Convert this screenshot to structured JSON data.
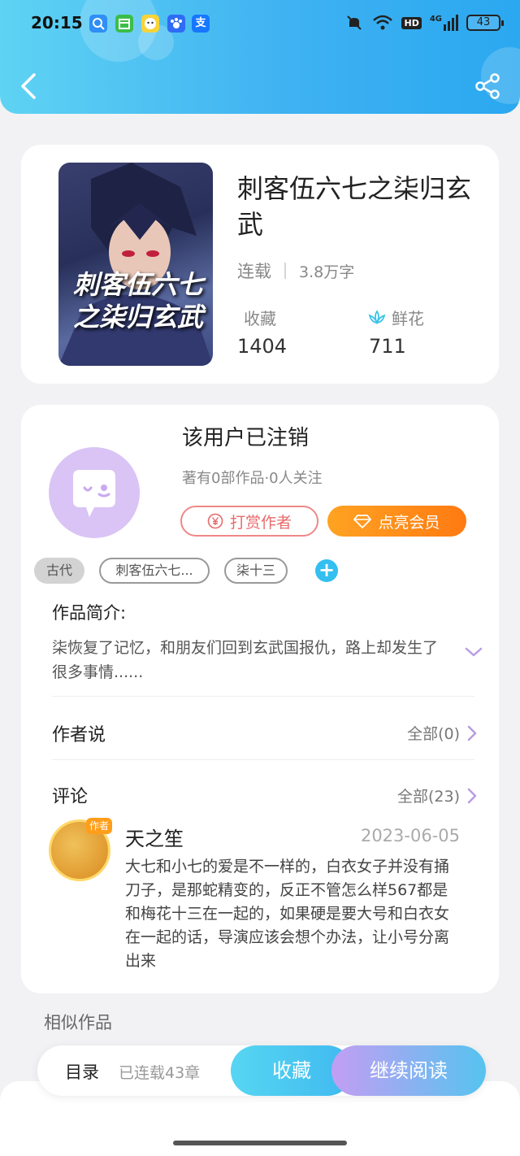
{
  "status_bar": {
    "time": "20:15",
    "battery": "43",
    "network": "4G",
    "hd": "HD",
    "app_icons": [
      "search-app-icon",
      "calendar-app-icon",
      "smile-app-icon",
      "paw-app-icon",
      "alipay-app-icon"
    ],
    "alipay_char": "支"
  },
  "header": {
    "back_icon": "back-chevron-icon",
    "share_icon": "share-icon"
  },
  "book": {
    "cover_text": "刺客伍六七之柒归玄武",
    "title": "刺客伍六七之柒归玄武",
    "status": "连载",
    "word_count": "3.8万字",
    "collect_label": "收藏",
    "collect_count": "1404",
    "flower_label": "鲜花",
    "flower_count": "711"
  },
  "author": {
    "name": "该用户已注销",
    "meta": "著有0部作品·0人关注",
    "reward_label": "打赏作者",
    "vip_label": "点亮会员",
    "tags": [
      "古代",
      "刺客伍六七...",
      "柒十三"
    ]
  },
  "synopsis": {
    "title": "作品简介:",
    "text": "柒恢复了记忆，和朋友们回到玄武国报仇，路上却发生了很多事情......"
  },
  "author_says": {
    "title": "作者说",
    "link": "全部(0)"
  },
  "comments": {
    "title": "评论",
    "link": "全部(23)",
    "items": [
      {
        "badge": "作者",
        "user": "天之笙",
        "date": "2023-06-05",
        "text": "大七和小七的爱是不一样的，白衣女子并没有捅刀子，是那蛇精变的，反正不管怎么样567都是和梅花十三在一起的，如果硬是要大号和白衣女在一起的话，导演应该会想个办法，让小号分离出来"
      }
    ]
  },
  "similar": {
    "title": "相似作品"
  },
  "bottom_bar": {
    "toc_label": "目录",
    "chapters": "已连载43章",
    "collect_label": "收藏",
    "read_label": "继续阅读"
  },
  "colors": {
    "header_start": "#5fd3f3",
    "header_end": "#2aa8f0",
    "vip_orange": "#ff8c1a",
    "reward_red": "#e86b6b",
    "accent_blue": "#33bff0",
    "avatar_purple": "#d9c4f5"
  }
}
